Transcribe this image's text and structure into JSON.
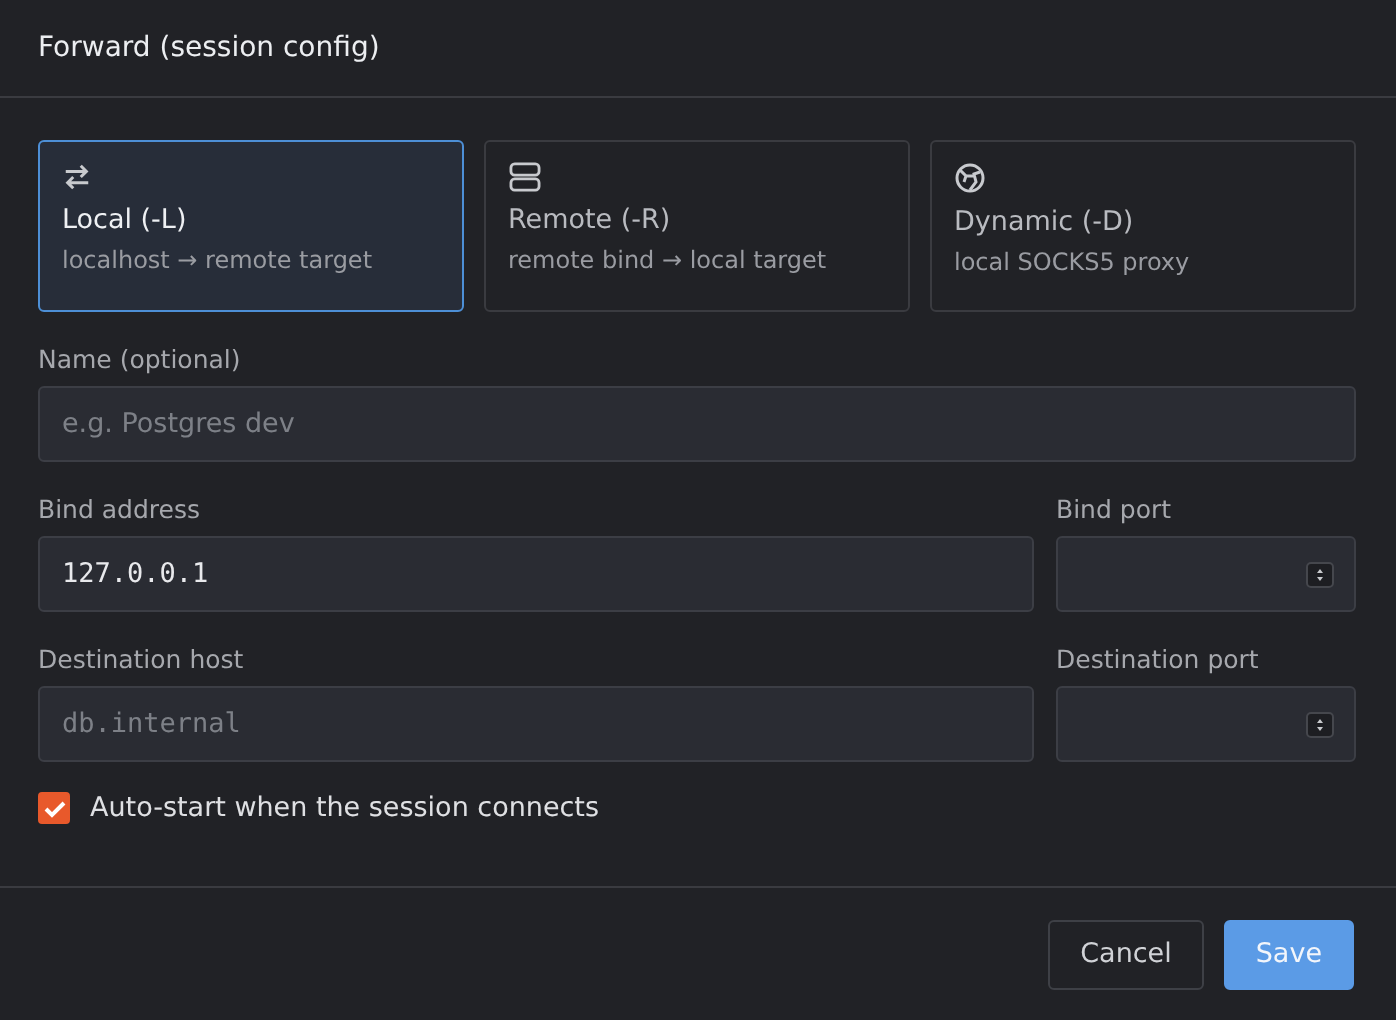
{
  "dialog": {
    "title": "Forward (session config)"
  },
  "modes": [
    {
      "kind": "local",
      "label": "Local (-L)",
      "description": "localhost → remote target",
      "selected": true
    },
    {
      "kind": "remote",
      "label": "Remote (-R)",
      "description": "remote bind → local target",
      "selected": false
    },
    {
      "kind": "dynamic",
      "label": "Dynamic (-D)",
      "description": "local SOCKS5 proxy",
      "selected": false
    }
  ],
  "name_field": {
    "label": "Name (optional)",
    "placeholder": "e.g. Postgres dev"
  },
  "rows": [
    {
      "host": {
        "label": "Bind address",
        "value": "127.0.0.1"
      },
      "port": {
        "label": "Bind port"
      }
    },
    {
      "host": {
        "label": "Destination host",
        "placeholder": "db.internal"
      },
      "port": {
        "label": "Destination port"
      }
    }
  ],
  "auto_start": {
    "label": "Auto-start when the session connects",
    "checked": true
  },
  "buttons": [
    {
      "kind": "secondary",
      "label": "Cancel"
    },
    {
      "kind": "primary",
      "label": "Save"
    }
  ]
}
